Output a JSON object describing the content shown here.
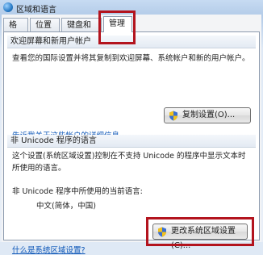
{
  "window": {
    "title": "区域和语言"
  },
  "tabs": [
    {
      "label": "格式"
    },
    {
      "label": "位置"
    },
    {
      "label": "键盘和语言"
    },
    {
      "label": "管理"
    }
  ],
  "welcome_group": {
    "header": "欢迎屏幕和新用户帐户",
    "description": "查看您的国际设置并将其复制到欢迎屏幕、系统帐户和新的用户帐户。",
    "copy_button_label": "复制设置(O)...",
    "link_text": "告诉我关于这些帐户的详细信息"
  },
  "unicode_group": {
    "header": "非 Unicode 程序的语言",
    "description": "这个设置(系统区域设置)控制在不支持 Unicode 的程序中显示文本时所使用的语言。",
    "current_label": "非 Unicode 程序中所使用的当前语言:",
    "current_value": "中文(简体，中国)",
    "change_button_label": "更改系统区域设置(C)...",
    "link_text": "什么是系统区域设置?"
  },
  "icons": {
    "window": "globe-icon",
    "button": "uac-shield-icon"
  },
  "colors": {
    "highlight": "#b3141e",
    "link": "#0b55b7"
  }
}
